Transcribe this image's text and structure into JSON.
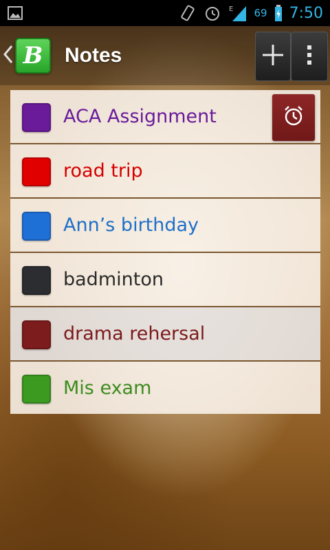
{
  "status_bar": {
    "time": "7:50",
    "battery_percent": "69",
    "network_type": "E",
    "icons": [
      "gallery-icon",
      "screen-rotate-icon",
      "alarm-clock-icon",
      "signal-icon",
      "battery-icon"
    ]
  },
  "action_bar": {
    "title": "Notes",
    "logo_letter": "B",
    "add_icon": "plus-icon",
    "overflow_icon": "overflow-menu-icon"
  },
  "notes": [
    {
      "label": "ACA Assignment",
      "color": "#6a1b9a",
      "swatch": "#6a1b9a",
      "has_alarm": true
    },
    {
      "label": "road trip",
      "color": "#d50000",
      "swatch": "#e00000"
    },
    {
      "label": "Ann’s birthday",
      "color": "#1e6fc8",
      "swatch": "#1e6fd6"
    },
    {
      "label": "badminton",
      "color": "#2a2a2a",
      "swatch": "#2b2d31"
    },
    {
      "label": "drama rehersal",
      "color": "#7a1a1a",
      "swatch": "#7d1c1c"
    },
    {
      "label": "Mis exam",
      "color": "#3c8c1e",
      "swatch": "#3c9a20"
    }
  ],
  "colors": {
    "accent_blue": "#33b5e5",
    "alarm_button": "#7a1e1e",
    "logo_green": "#27a52a"
  }
}
